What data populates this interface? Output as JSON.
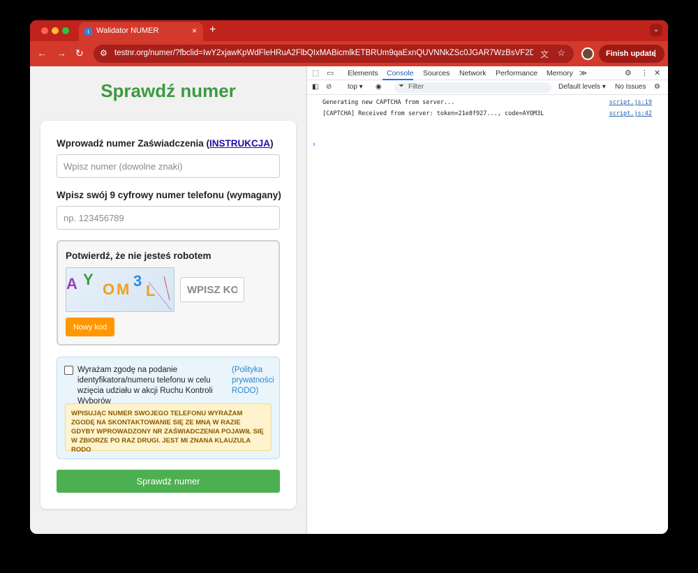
{
  "browser": {
    "tab_title": "Walidator NUMER",
    "tab_close": "×",
    "new_tab": "+",
    "tab_menu_icon": "⌄",
    "url": "testnr.org/numer/?fbclid=IwY2xjawKpWdFleHRuA2FlbQIxMABicmlkETBRUm9qaExnQUVNNkZSc0JGAR7WzBsVF2DD...",
    "finish_update": "Finish update",
    "back_icon": "←",
    "forward_icon": "→",
    "reload_icon": "↻",
    "site_icon": "⚙",
    "translate_icon": "文",
    "star_icon": "☆",
    "menu_icon": "⋮"
  },
  "page": {
    "title": "Sprawdź numer",
    "cert_label_prefix": "Wprowadź numer Zaświadczenia (",
    "cert_link": "INSTRUKCJA",
    "cert_label_suffix": ")",
    "cert_placeholder": "Wpisz numer (dowolne znaki)",
    "phone_label": "Wpisz swój 9 cyfrowy numer telefonu (wymagany)",
    "phone_placeholder": "np. 123456789",
    "captcha": {
      "title": "Potwierdź, że nie jesteś robotem",
      "chars": [
        "A",
        "Y",
        "O",
        "M",
        "3",
        "L"
      ],
      "input_placeholder": "WPISZ KOD",
      "new_code": "Nowy kod"
    },
    "consent": {
      "text": "Wyrażam zgodę na podanie identyfikatora/numeru telefonu w celu wzięcia udziału w akcji Ruchu Kontroli Wyborów",
      "policy_link": "(Polityka prywatności RODO)",
      "warning": "WPISUJĄC NUMER SWOJEGO TELEFONU WYRAŻAM ZGODĘ NA SKONTAKTOWANIE SIĘ ZE MNĄ W RAZIE GDYBY WPROWADZONY NR ZAŚWIADCZENIA POJAWIŁ SIĘ W ZBIORZE PO RAZ DRUGI. JEST MI ZNANA KLAUZULA RODO"
    },
    "submit": "Sprawdź numer"
  },
  "devtools": {
    "tabs": [
      "Elements",
      "Console",
      "Sources",
      "Network",
      "Performance",
      "Memory"
    ],
    "more_icon": "≫",
    "context": "top ▾",
    "filter_placeholder": "Filter",
    "levels": "Default levels ▾",
    "issues": "No Issues",
    "logs": [
      {
        "message": "Generating new CAPTCHA from server...",
        "source": "script.js:19"
      },
      {
        "message": "[CAPTCHA] Received from server: token=21e8f927..., code=AYOM3L",
        "source": "script.js:42"
      }
    ],
    "prompt": "›"
  }
}
